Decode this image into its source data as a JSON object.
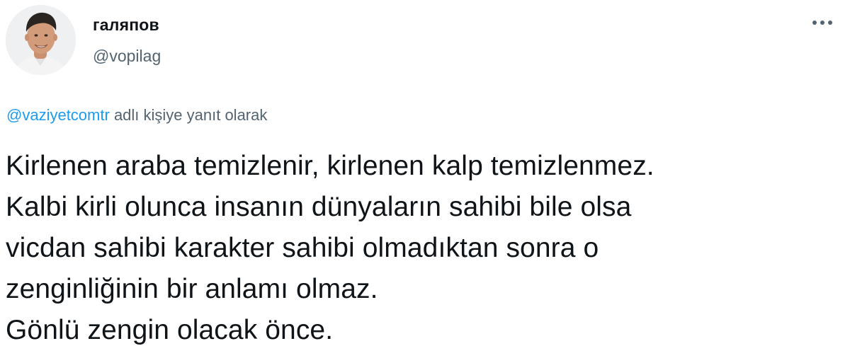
{
  "author": {
    "display_name": "галяпов",
    "handle": "@vopilag",
    "avatar_icon": "user-avatar-photo"
  },
  "menu": {
    "more_icon": "more-horizontal-icon"
  },
  "reply_context": {
    "mention": "@vaziyetcomtr",
    "suffix": "adlı kişiye yanıt olarak"
  },
  "tweet": {
    "lines": [
      "Kirlenen araba temizlenir, kirlenen kalp temizlenmez.",
      "Kalbi kirli olunca insanın dünyaların sahibi bile olsa",
      "vicdan sahibi karakter sahibi olmadıktan sonra o",
      "zenginliğinin bir anlamı olmaz.",
      "Gönlü zengin olacak önce."
    ]
  },
  "colors": {
    "text": "#0f1419",
    "secondary": "#536471",
    "link": "#1d9bf0"
  }
}
